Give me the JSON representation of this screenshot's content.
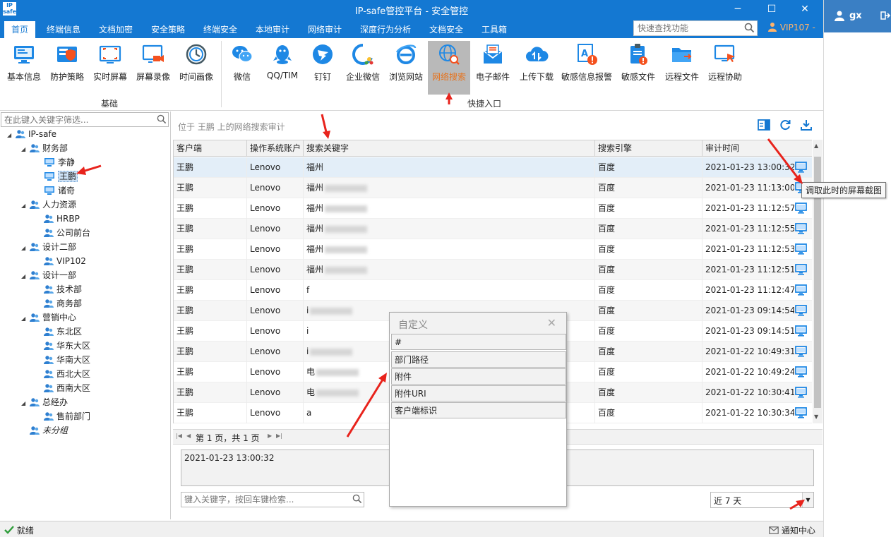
{
  "app": {
    "title": "IP-safe管控平台 - 安全管控",
    "logo_line1": "IP",
    "logo_line2": "safe",
    "minimize": "─",
    "maximize": "☐",
    "close": "✕"
  },
  "menu": {
    "items": [
      "首页",
      "终端信息",
      "文档加密",
      "安全策略",
      "终端安全",
      "本地审计",
      "网络审计",
      "深度行为分析",
      "文档安全",
      "工具箱"
    ],
    "active_index": 0,
    "quick_search_placeholder": "快速查找功能",
    "vip_label": "VIP107 -"
  },
  "user": {
    "name": "gx"
  },
  "ribbon": {
    "basic_group_label": "基础",
    "quick_group_label": "快捷入口",
    "basic_tools": [
      "基本信息",
      "防护策略",
      "实时屏幕",
      "屏幕录像",
      "时间画像"
    ],
    "quick_tools": [
      "微信",
      "QQ/TIM",
      "钉钉",
      "企业微信",
      "浏览网站",
      "网络搜索",
      "电子邮件",
      "上传下载",
      "敏感信息报警",
      "敏感文件",
      "远程文件",
      "远程协助"
    ],
    "active_tool": "网络搜索"
  },
  "tree": {
    "search_placeholder": "在此键入关键字筛选...",
    "nodes": [
      {
        "label": "IP-safe",
        "level": 0,
        "type": "root"
      },
      {
        "label": "财务部",
        "level": 1,
        "type": "group"
      },
      {
        "label": "李静",
        "level": 2,
        "type": "pc"
      },
      {
        "label": "王鹏",
        "level": 2,
        "type": "pc",
        "selected": true
      },
      {
        "label": "诸奇",
        "level": 2,
        "type": "pc"
      },
      {
        "label": "人力资源",
        "level": 1,
        "type": "group"
      },
      {
        "label": "HRBP",
        "level": 2,
        "type": "user"
      },
      {
        "label": "公司前台",
        "level": 2,
        "type": "user"
      },
      {
        "label": "设计二部",
        "level": 1,
        "type": "group"
      },
      {
        "label": "VIP102",
        "level": 2,
        "type": "user"
      },
      {
        "label": "设计一部",
        "level": 1,
        "type": "group"
      },
      {
        "label": "技术部",
        "level": 2,
        "type": "user"
      },
      {
        "label": "商务部",
        "level": 2,
        "type": "user"
      },
      {
        "label": "营销中心",
        "level": 1,
        "type": "group"
      },
      {
        "label": "东北区",
        "level": 2,
        "type": "user"
      },
      {
        "label": "华东大区",
        "level": 2,
        "type": "user"
      },
      {
        "label": "华南大区",
        "level": 2,
        "type": "user"
      },
      {
        "label": "西北大区",
        "level": 2,
        "type": "user"
      },
      {
        "label": "西南大区",
        "level": 2,
        "type": "user"
      },
      {
        "label": "总经办",
        "level": 1,
        "type": "group"
      },
      {
        "label": "售前部门",
        "level": 2,
        "type": "user"
      },
      {
        "label": "未分组",
        "level": 1,
        "type": "ungrouped"
      }
    ]
  },
  "main": {
    "breadcrumb": "位于 王鹏 上的网络搜索审计",
    "columns": [
      "客户端",
      "操作系统账户",
      "搜索关键字",
      "搜索引擎",
      "审计时间"
    ],
    "rows": [
      {
        "client": "王鹏",
        "account": "Lenovo",
        "keyword": "福州",
        "engine": "百度",
        "time": "2021-01-23 13:00:32",
        "blur": false
      },
      {
        "client": "王鹏",
        "account": "Lenovo",
        "keyword": "福州",
        "engine": "百度",
        "time": "2021-01-23 11:13:00",
        "blur": true
      },
      {
        "client": "王鹏",
        "account": "Lenovo",
        "keyword": "福州",
        "engine": "百度",
        "time": "2021-01-23 11:12:57",
        "blur": true
      },
      {
        "client": "王鹏",
        "account": "Lenovo",
        "keyword": "福州",
        "engine": "百度",
        "time": "2021-01-23 11:12:55",
        "blur": true
      },
      {
        "client": "王鹏",
        "account": "Lenovo",
        "keyword": "福州",
        "engine": "百度",
        "time": "2021-01-23 11:12:53",
        "blur": true
      },
      {
        "client": "王鹏",
        "account": "Lenovo",
        "keyword": "福州",
        "engine": "百度",
        "time": "2021-01-23 11:12:51",
        "blur": true
      },
      {
        "client": "王鹏",
        "account": "Lenovo",
        "keyword": "f",
        "engine": "百度",
        "time": "2021-01-23 11:12:47",
        "blur": false
      },
      {
        "client": "王鹏",
        "account": "Lenovo",
        "keyword": "i",
        "engine": "百度",
        "time": "2021-01-23 09:14:54",
        "blur": true
      },
      {
        "client": "王鹏",
        "account": "Lenovo",
        "keyword": "i",
        "engine": "百度",
        "time": "2021-01-23 09:14:51",
        "blur": false
      },
      {
        "client": "王鹏",
        "account": "Lenovo",
        "keyword": "i",
        "engine": "百度",
        "time": "2021-01-22 10:49:31",
        "blur": true
      },
      {
        "client": "王鹏",
        "account": "Lenovo",
        "keyword": "电",
        "engine": "百度",
        "time": "2021-01-22 10:49:24",
        "blur": true
      },
      {
        "client": "王鹏",
        "account": "Lenovo",
        "keyword": "电",
        "engine": "百度",
        "time": "2021-01-22 10:30:41",
        "blur": true
      },
      {
        "client": "王鹏",
        "account": "Lenovo",
        "keyword": "a",
        "engine": "百度",
        "time": "2021-01-22 10:30:34",
        "blur": false
      }
    ],
    "pager_info": "第 1 页，共 1 页",
    "detail_text": "2021-01-23 13:00:32",
    "keyword_placeholder": "键入关键字，按回车键检索...",
    "range_value": "近 7 天"
  },
  "tooltip": {
    "text": "调取此时的屏幕截图"
  },
  "popup": {
    "title": "自定义",
    "items": [
      "#",
      "部门路径",
      "附件",
      "附件URI",
      "客户端标识"
    ]
  },
  "status": {
    "ready": "就绪",
    "notice": "通知中心"
  },
  "colors": {
    "primary": "#1478d2",
    "active_tool_bg": "#b9b9b9",
    "active_tool_text": "#e6731d",
    "annotation_arrow": "#e8231c"
  }
}
